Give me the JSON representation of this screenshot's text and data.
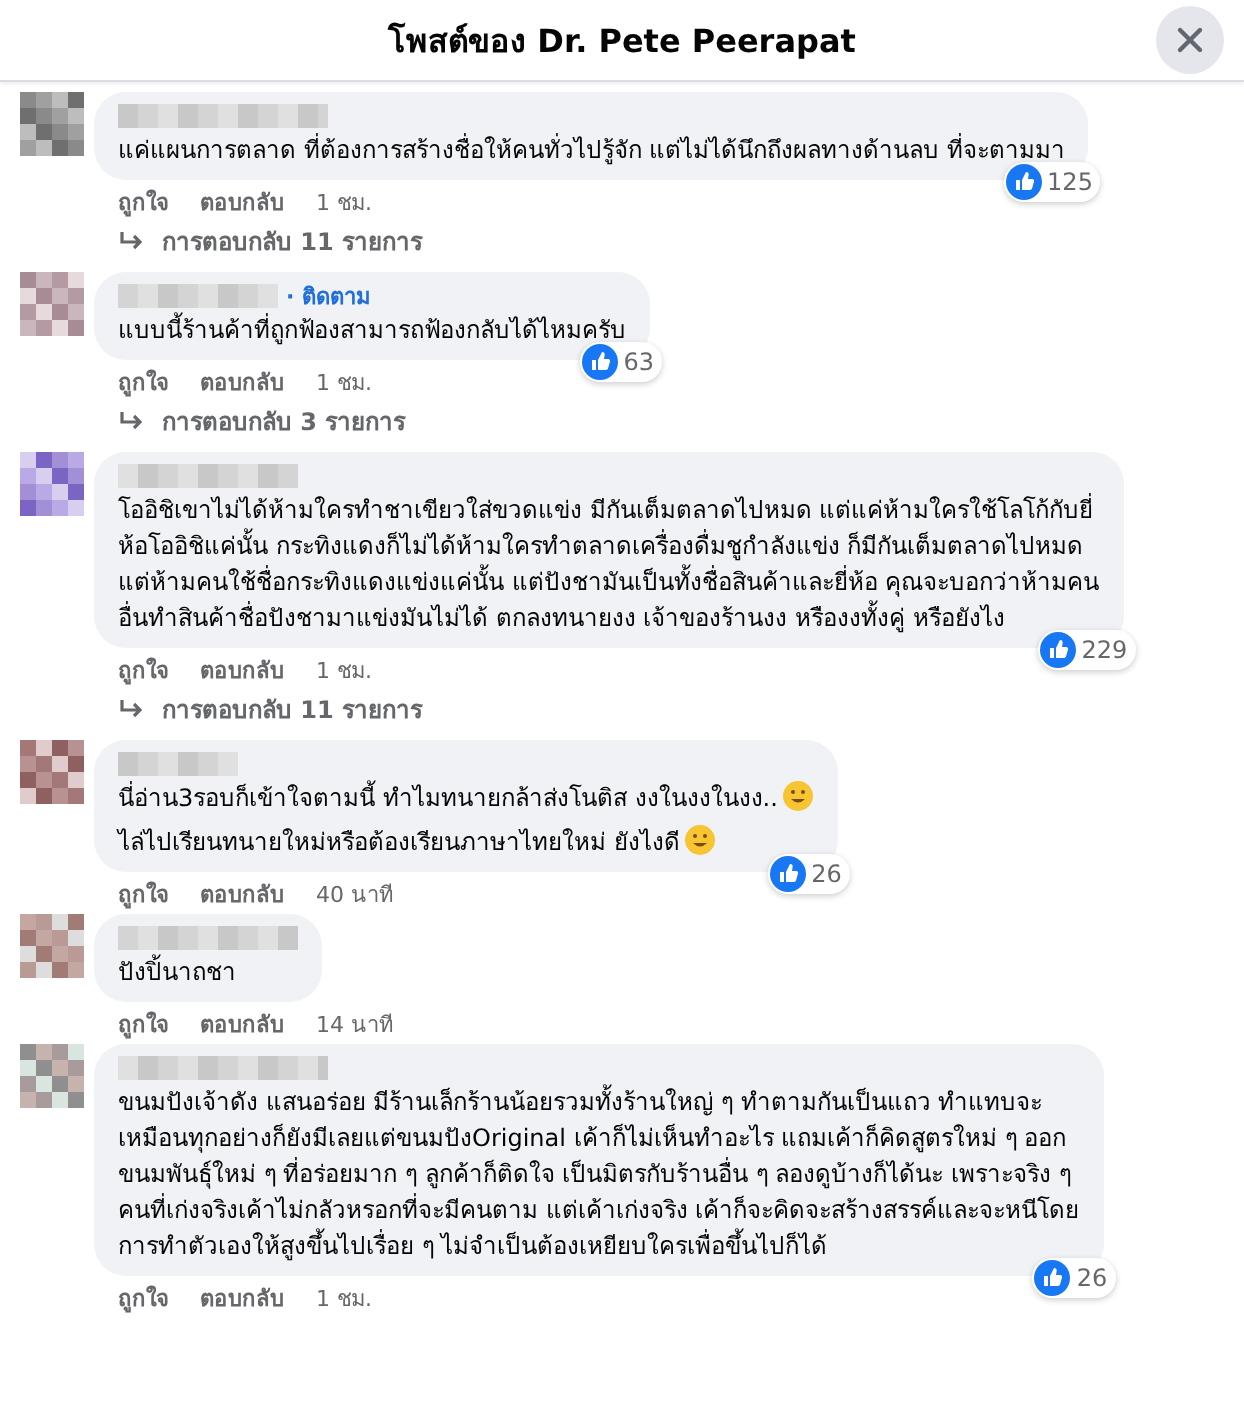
{
  "header": {
    "title": "โพสต์ของ Dr. Pete Peerapat"
  },
  "comments": [
    {
      "paragraphs": [
        {
          "lines": [
            "แค่แผนการตลาด ที่ต้องการสร้างชื่อให้คนทั่วไปรู้จัก แต่ไม่ได้นึกถึงผลทางด้านลบ ที่จะตามมา"
          ],
          "emoji": false
        }
      ],
      "reactions": "125",
      "actions": [
        "ถูกใจ",
        "ตอบกลับ"
      ],
      "time": "1 ชม.",
      "replies": "การตอบกลับ 11 รายการ"
    },
    {
      "follow": "· ติดตาม",
      "paragraphs": [
        {
          "lines": [
            "แบบนี้ร้านค้าที่ถูกฟ้องสามารถฟ้องกลับได้ไหมครับ"
          ],
          "emoji": false
        }
      ],
      "reactions": "63",
      "actions": [
        "ถูกใจ",
        "ตอบกลับ"
      ],
      "time": "1 ชม.",
      "replies": "การตอบกลับ 3 รายการ"
    },
    {
      "paragraphs": [
        {
          "lines": [
            "โออิชิเขาไม่ได้ห้ามใครทำชาเขียวใส่ขวดแข่ง มีกันเต็มตลาดไปหมด แต่แค่ห้ามใครใช้โลโก้กับยี่",
            "ห้อโออิชิแค่นั้น กระทิงแดงก็ไม่ได้ห้ามใครทำตลาดเครื่องดื่มชูกำลังแข่ง ก็มีกันเต็มตลาดไปหมด",
            "แต่ห้ามคนใช้ชื่อกระทิงแดงแข่งแค่นั้น แต่ปังชามันเป็นทั้งชื่อสินค้าและยี่ห้อ คุณจะบอกว่าห้ามคน",
            "อื่นทำสินค้าชื่อปังชามาแข่งมันไม่ได้ ตกลงทนายงง เจ้าของร้านงง หรืองงทั้งคู่ หรือยังไง"
          ],
          "emoji": false
        }
      ],
      "reactions": "229",
      "actions": [
        "ถูกใจ",
        "ตอบกลับ"
      ],
      "time": "1 ชม.",
      "replies": "การตอบกลับ 11 รายการ"
    },
    {
      "paragraphs": [
        {
          "lines": [
            "นี่อ่าน3รอบก็เข้าใจตามนี้ ทำไมทนายกล้าส่งโนติส งงในงงในงง.."
          ],
          "emoji": true
        },
        {
          "lines": [
            "ไล่ไปเรียนทนายใหม่หรือต้องเรียนภาษาไทยใหม่ ยังไงดี"
          ],
          "emoji": true
        }
      ],
      "reactions": "26",
      "actions": [
        "ถูกใจ",
        "ตอบกลับ"
      ],
      "time": "40 นาที"
    },
    {
      "paragraphs": [
        {
          "lines": [
            "ปังปิ้นาถชา"
          ],
          "emoji": false
        }
      ],
      "actions": [
        "ถูกใจ",
        "ตอบกลับ"
      ],
      "time": "14 นาที"
    },
    {
      "paragraphs": [
        {
          "lines": [
            "ขนมปังเจ้าดัง แสนอร่อย มีร้านเล็กร้านน้อยรวมทั้งร้านใหญ่ ๆ ทำตามกันเป็นแถว ทำแทบจะ",
            "เหมือนทุกอย่างก็ยังมีเลยแต่ขนมปังOriginal เค้าก็ไม่เห็นทำอะไร แถมเค้าก็คิดสูตรใหม่ ๆ ออก",
            "ขนมพันธุ์ใหม่ ๆ ที่อร่อยมาก ๆ ลูกค้าก็ติดใจ เป็นมิตรกับร้านอื่น ๆ ลองดูบ้างก็ได้นะ เพราะจริง ๆ",
            "คนที่เก่งจริงเค้าไม่กลัวหรอกที่จะมีคนตาม แต่เค้าเก่งจริง เค้าก็จะคิดจะสร้างสรรค์และจะหนีโดย",
            "การทำตัวเองให้สูงขึ้นไปเรื่อย ๆ ไม่จำเป็นต้องเหยียบใครเพื่อขึ้นไปก็ได้"
          ],
          "emoji": false
        }
      ],
      "reactions": "26",
      "actions": [
        "ถูกใจ",
        "ตอบกลับ"
      ],
      "time": "1 ชม."
    }
  ]
}
